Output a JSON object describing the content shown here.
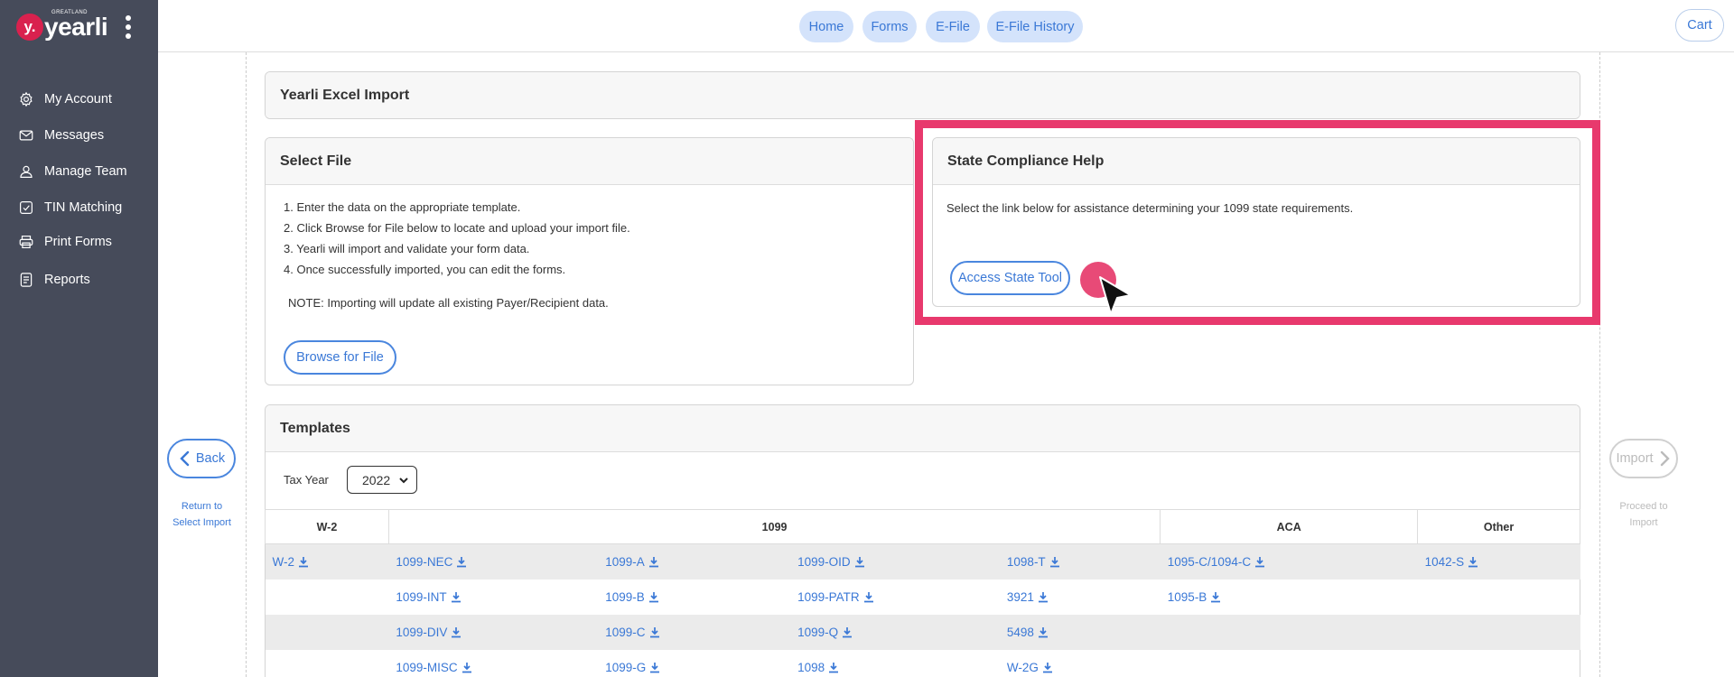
{
  "brand": {
    "name": "yearli",
    "badge": "y.",
    "sub": "GREATLAND"
  },
  "sidebar": {
    "items": [
      {
        "label": "My Account",
        "icon": "gear-icon"
      },
      {
        "label": "Messages",
        "icon": "envelope-icon"
      },
      {
        "label": "Manage Team",
        "icon": "user-icon"
      },
      {
        "label": "TIN Matching",
        "icon": "check-square-icon"
      },
      {
        "label": "Print Forms",
        "icon": "printer-icon"
      },
      {
        "label": "Reports",
        "icon": "report-icon"
      }
    ]
  },
  "header": {
    "tabs": [
      "Home",
      "Forms",
      "E-File",
      "E-File History"
    ],
    "cart": "Cart"
  },
  "import_panel": {
    "title": "Yearli Excel Import"
  },
  "select_file": {
    "title": "Select File",
    "steps": [
      "1. Enter the data on the appropriate template.",
      "2. Click Browse for File below to locate and upload your import file.",
      "3. Yearli will import and validate your form data.",
      "4. Once successfully imported, you can edit the forms."
    ],
    "note": "NOTE: Importing will update all existing Payer/Recipient data.",
    "browse_button": "Browse for File"
  },
  "state_help": {
    "title": "State Compliance Help",
    "text": "Select the link below for assistance determining your 1099 state requirements.",
    "button": "Access State Tool"
  },
  "nav_buttons": {
    "back": "Back",
    "back_caption_1": "Return to",
    "back_caption_2": "Select Import",
    "import": "Import",
    "import_caption_1": "Proceed to",
    "import_caption_2": "Import"
  },
  "templates": {
    "title": "Templates",
    "tax_year_label": "Tax Year",
    "tax_year_value": "2022",
    "headers": [
      "W-2",
      "1099",
      "ACA",
      "Other"
    ],
    "rows": [
      [
        "W-2",
        "1099-NEC",
        "1099-A",
        "1099-OID",
        "1098-T",
        "1095-C/1094-C",
        "1042-S"
      ],
      [
        "",
        "1099-INT",
        "1099-B",
        "1099-PATR",
        "3921",
        "1095-B",
        ""
      ],
      [
        "",
        "1099-DIV",
        "1099-C",
        "1099-Q",
        "5498",
        "",
        ""
      ],
      [
        "",
        "1099-MISC",
        "1099-G",
        "1098",
        "W-2G",
        "",
        ""
      ]
    ]
  },
  "colors": {
    "accent": "#3a78d6",
    "highlight": "#e8396d",
    "sidebar": "#464b5a"
  }
}
